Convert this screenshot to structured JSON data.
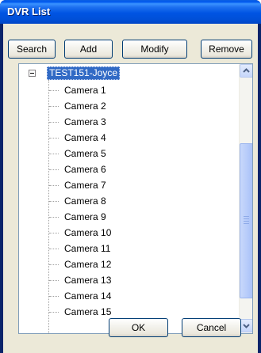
{
  "window": {
    "title": "DVR List"
  },
  "toolbar": {
    "search_label": "Search",
    "add_label": "Add",
    "modify_label": "Modify",
    "remove_label": "Remove"
  },
  "tree": {
    "root": {
      "label": "TEST151-Joyce",
      "expanded": true,
      "selected": true
    },
    "children": [
      "Camera 1",
      "Camera 2",
      "Camera 3",
      "Camera 4",
      "Camera 5",
      "Camera 6",
      "Camera 7",
      "Camera 8",
      "Camera 9",
      "Camera 10",
      "Camera 11",
      "Camera 12",
      "Camera 13",
      "Camera 14",
      "Camera 15"
    ]
  },
  "footer": {
    "ok_label": "OK",
    "cancel_label": "Cancel"
  },
  "icons": {
    "expand": "minus-box-icon",
    "scroll_up": "arrow-up-icon",
    "scroll_down": "arrow-down-icon"
  },
  "colors": {
    "titlebar": "#0054e3",
    "selection": "#316ac5",
    "face": "#ece9d8"
  }
}
